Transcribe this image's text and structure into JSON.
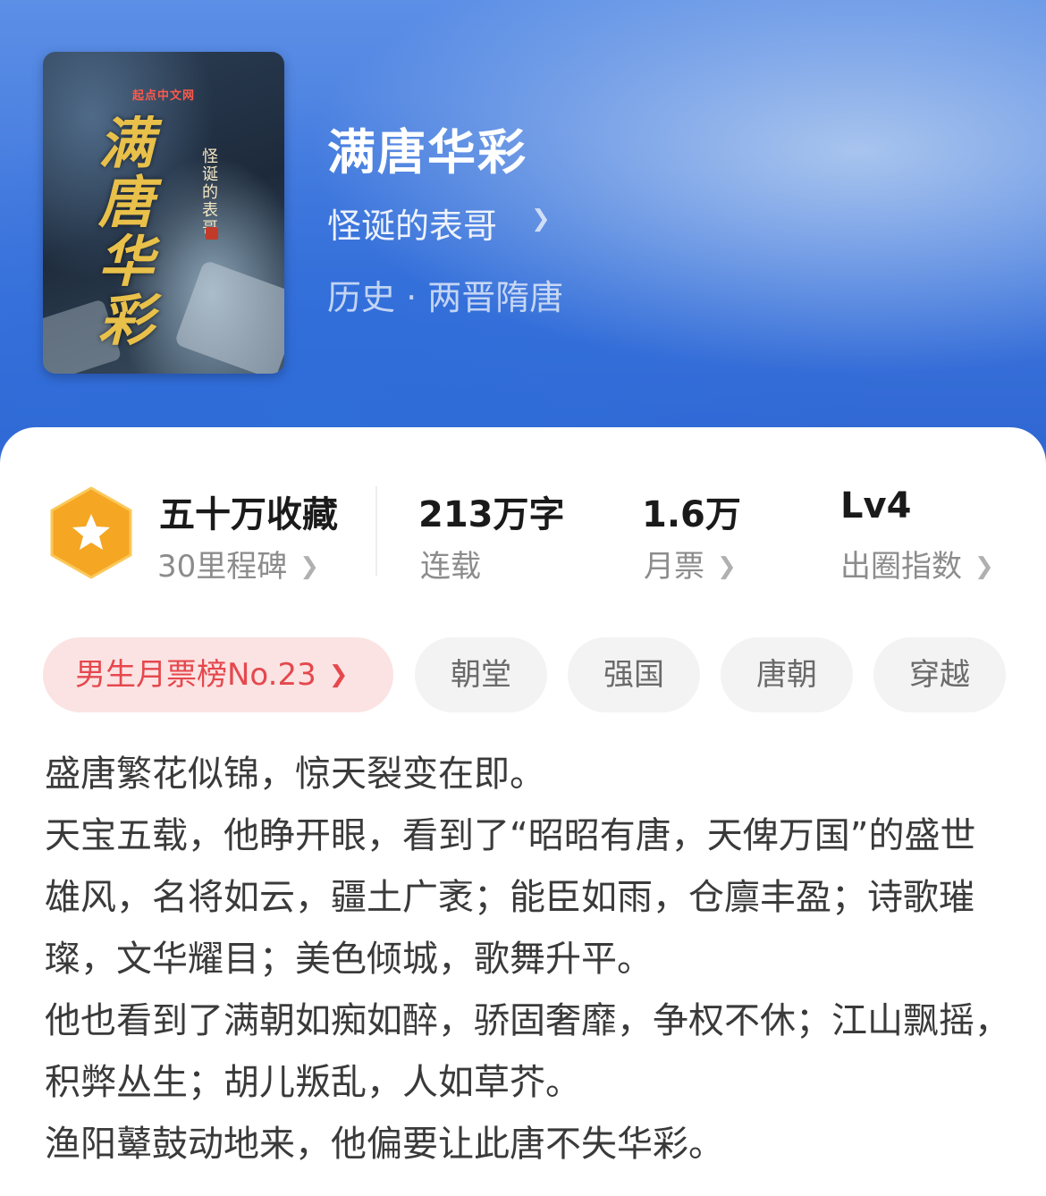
{
  "book": {
    "title": "满唐华彩",
    "author": "怪诞的表哥",
    "category": "历史 · 两晋隋唐",
    "cover": {
      "publisher": "起点中文网",
      "calligraphy": "满唐华彩",
      "author": "怪诞的表哥"
    }
  },
  "stats": {
    "collections": {
      "title": "五十万收藏",
      "sub": "30里程碑"
    },
    "words": {
      "title": "213万字",
      "sub": "连载"
    },
    "monthly_votes": {
      "title": "1.6万",
      "sub": "月票"
    },
    "influence": {
      "title": "Lv4",
      "sub": "出圈指数"
    }
  },
  "tags": {
    "rank": "男生月票榜No.23",
    "items": [
      "朝堂",
      "强国",
      "唐朝",
      "穿越"
    ]
  },
  "description": [
    "盛唐繁花似锦，惊天裂变在即。",
    "天宝五载，他睁开眼，看到了“昭昭有唐，天俾万国”的盛世雄风，名将如云，疆土广袤；能臣如雨，仓廪丰盈；诗歌璀璨，文华耀目；美色倾城，歌舞升平。",
    "他也看到了满朝如痴如醉，骄固奢靡，争权不休；江山飘摇，积弊丛生；胡儿叛乱，人如草芥。",
    "渔阳鼙鼓动地来，他偏要让此唐不失华彩。"
  ],
  "icons": {
    "badge": "star-hexagon-icon",
    "chevron": "chevron-right-icon"
  },
  "colors": {
    "header": "#3c74dc",
    "badge": "#f5a623",
    "rank_text": "#e5484d",
    "rank_bg": "#fbe3e3"
  }
}
